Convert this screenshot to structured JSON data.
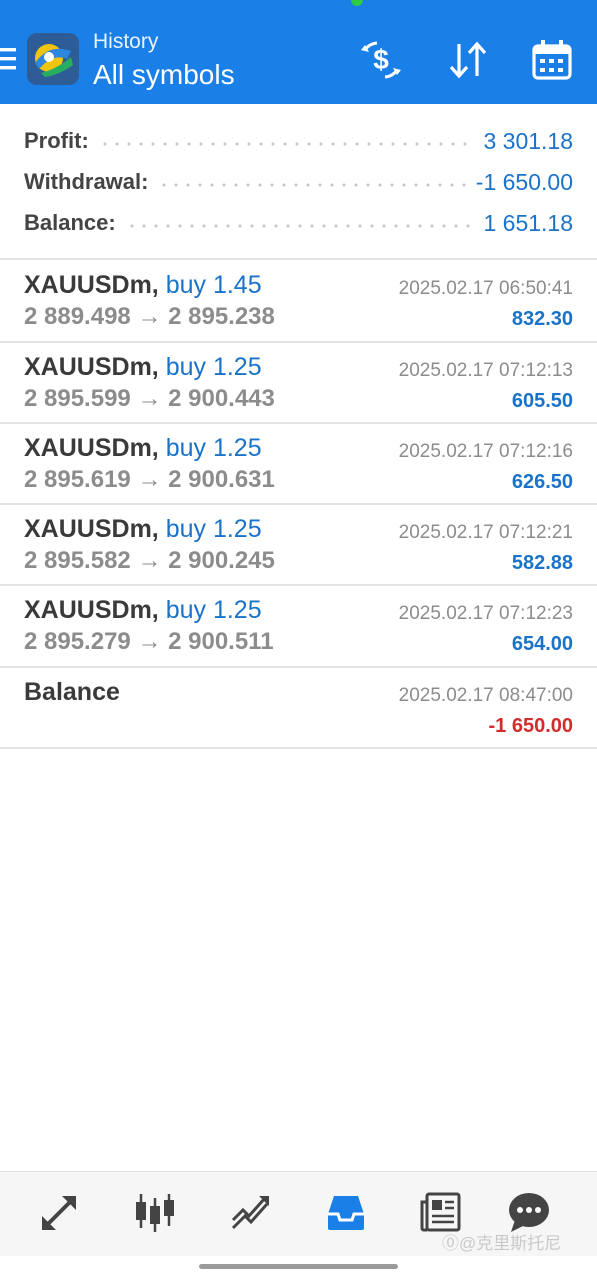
{
  "header": {
    "subtitle": "History",
    "title": "All symbols",
    "icons": [
      "menu-icon",
      "deposit-withdraw-icon",
      "sort-icon",
      "calendar-icon"
    ],
    "color": "#1a7fe6"
  },
  "summary": {
    "profit_label": "Profit:",
    "profit_value": "3 301.18",
    "withdrawal_label": "Withdrawal:",
    "withdrawal_value": "-1 650.00",
    "balance_label": "Balance:",
    "balance_value": "1 651.18"
  },
  "trades": [
    {
      "symbol": "XAUUSDm,",
      "side": "buy 1.45",
      "prices": "2 889.498 → 2 895.238",
      "time": "2025.02.17 06:50:41",
      "profit": "832.30"
    },
    {
      "symbol": "XAUUSDm,",
      "side": "buy 1.25",
      "prices": "2 895.599 → 2 900.443",
      "time": "2025.02.17 07:12:13",
      "profit": "605.50"
    },
    {
      "symbol": "XAUUSDm,",
      "side": "buy 1.25",
      "prices": "2 895.619 → 2 900.631",
      "time": "2025.02.17 07:12:16",
      "profit": "626.50"
    },
    {
      "symbol": "XAUUSDm,",
      "side": "buy 1.25",
      "prices": "2 895.582 → 2 900.245",
      "time": "2025.02.17 07:12:21",
      "profit": "582.88"
    },
    {
      "symbol": "XAUUSDm,",
      "side": "buy 1.25",
      "prices": "2 895.279 → 2 900.511",
      "time": "2025.02.17 07:12:23",
      "profit": "654.00"
    }
  ],
  "balance_entry": {
    "label": "Balance",
    "time": "2025.02.17 08:47:00",
    "amount": "-1 650.00"
  },
  "bottom_nav": {
    "items": [
      "quotes-icon",
      "chart-icon",
      "trade-icon",
      "history-icon",
      "news-icon",
      "chat-icon"
    ],
    "active": "history-icon"
  },
  "watermark": "⓪@克里斯托尼",
  "colors": {
    "accent": "#1a73c9",
    "negative": "#d22d2d",
    "active_nav": "#1a7fe6"
  }
}
